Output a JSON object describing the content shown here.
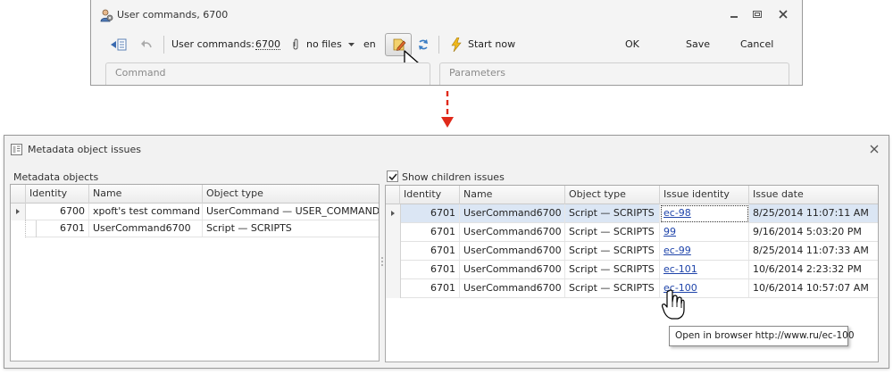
{
  "top_window": {
    "title": "User commands, 6700",
    "toolbar": {
      "label": "User commands:",
      "id_value": "6700",
      "files_label": "no files",
      "language": "en",
      "start_label": "Start now",
      "ok_label": "OK",
      "save_label": "Save",
      "cancel_label": "Cancel"
    },
    "groups": {
      "command": "Command",
      "parameters": "Parameters"
    }
  },
  "bottom_window": {
    "title": "Metadata object issues",
    "left_panel": {
      "label": "Metadata objects",
      "columns": [
        "Identity",
        "Name",
        "Object type"
      ],
      "rows": [
        {
          "identity": "6700",
          "name": "xpoft's test command",
          "type": "UserCommand — USER_COMMANDS"
        },
        {
          "identity": "6701",
          "name": "UserCommand6700",
          "type": "Script — SCRIPTS"
        }
      ]
    },
    "right_panel": {
      "checkbox_label": "Show children issues",
      "checkbox_checked": true,
      "columns": [
        "Identity",
        "Name",
        "Object type",
        "Issue identity",
        "Issue date"
      ],
      "rows": [
        {
          "identity": "6701",
          "name": "UserCommand6700",
          "type": "Script — SCRIPTS",
          "issue": "ec-98",
          "date": "8/25/2014 11:07:11 AM"
        },
        {
          "identity": "6701",
          "name": "UserCommand6700",
          "type": "Script — SCRIPTS",
          "issue": "99",
          "date": "9/16/2014 5:03:20 PM"
        },
        {
          "identity": "6701",
          "name": "UserCommand6700",
          "type": "Script — SCRIPTS",
          "issue": "ec-99",
          "date": "8/25/2014 11:07:33 AM"
        },
        {
          "identity": "6701",
          "name": "UserCommand6700",
          "type": "Script — SCRIPTS",
          "issue": "ec-101",
          "date": "10/6/2014 2:23:32 PM"
        },
        {
          "identity": "6701",
          "name": "UserCommand6700",
          "type": "Script — SCRIPTS",
          "issue": "ec-100",
          "date": "10/6/2014 10:57:07 AM"
        }
      ]
    },
    "tooltip": "Open in browser http://www.ru/ec-100"
  },
  "colors": {
    "accent_link": "#1f44aa",
    "selected_row": "#dbe6f4",
    "arrow": "#e0291a"
  }
}
